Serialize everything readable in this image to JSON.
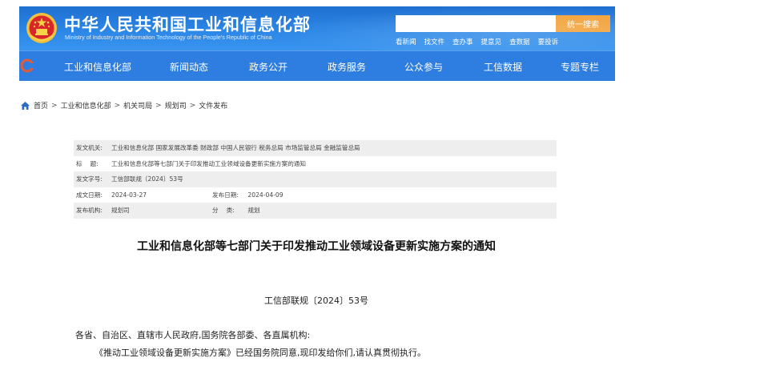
{
  "header": {
    "site_title": "中华人民共和国工业和信息化部",
    "site_subtitle": "Ministry of Industry and Information Technology of the People's Republic of China",
    "search": {
      "value": "",
      "button_label": "统一搜索"
    },
    "quick_links": [
      "看新闻",
      "找文件",
      "查办事",
      "提意见",
      "查数据",
      "要投诉"
    ],
    "colors": {
      "header_blue": "#2b86e6",
      "nav_blue": "#2d7ee0",
      "search_orange": "#f2a23a"
    }
  },
  "nav": {
    "items": [
      "工业和信息化部",
      "新闻动态",
      "政务公开",
      "政务服务",
      "公众参与",
      "工信数据",
      "专题专栏"
    ]
  },
  "breadcrumb": {
    "items": [
      "首页",
      "工业和信息化部",
      "机关司局",
      "规划司",
      "文件发布"
    ],
    "separator": ">"
  },
  "meta": {
    "issuer_label": "发文机关:",
    "issuer": "工业和信息化部 国家发展改革委 财政部 中国人民银行 税务总局 市场监管总局 金融监管总局",
    "title_label": "标　 题:",
    "title": "工业和信息化部等七部门关于印发推动工业领域设备更新实施方案的通知",
    "number_label": "发文字号:",
    "number": "工信部联规〔2024〕53号",
    "created_label": "成文日期:",
    "created": "2024-03-27",
    "published_label": "发布日期:",
    "published": "2024-04-09",
    "org_label": "发布机构:",
    "org": "规划司",
    "category_label": "分　 类:",
    "category": "规划"
  },
  "document": {
    "title": "工业和信息化部等七部门关于印发推动工业领域设备更新实施方案的通知",
    "number": "工信部联规〔2024〕53号",
    "salutation": "各省、自治区、直辖市人民政府,国务院各部委、各直属机构:",
    "body": "《推动工业领域设备更新实施方案》已经国务院同意,现印发给你们,请认真贯彻执行。"
  }
}
